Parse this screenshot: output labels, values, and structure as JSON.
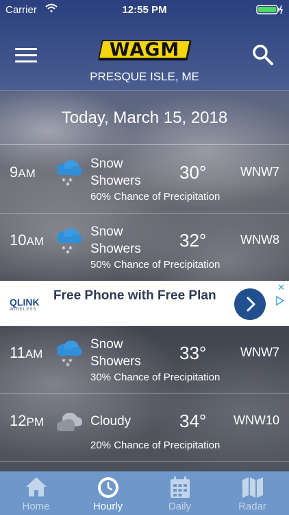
{
  "status_bar": {
    "carrier": "Carrier",
    "time": "12:55 PM"
  },
  "header": {
    "logo": "WAGM",
    "location": "PRESQUE ISLE, ME"
  },
  "date": "Today, March 15, 2018",
  "hours": [
    {
      "hour": "9",
      "ampm": "AM",
      "condition": "Snow Showers",
      "temp": "30°",
      "wind": "WNW7",
      "precip": "60% Chance of Precipitation",
      "icon": "snow-showers-icon"
    },
    {
      "hour": "10",
      "ampm": "AM",
      "condition": "Snow Showers",
      "temp": "32°",
      "wind": "WNW8",
      "precip": "50% Chance of Precipitation",
      "icon": "snow-showers-icon"
    },
    {
      "hour": "11",
      "ampm": "AM",
      "condition": "Snow Showers",
      "temp": "33°",
      "wind": "WNW7",
      "precip": "30% Chance of Precipitation",
      "icon": "snow-showers-icon"
    },
    {
      "hour": "12",
      "ampm": "PM",
      "condition": "Cloudy",
      "temp": "34°",
      "wind": "WNW10",
      "precip": "20% Chance of Precipitation",
      "icon": "cloudy-icon"
    }
  ],
  "ad": {
    "brand": "QLINK",
    "brand_sub": "WIRELESS",
    "text": "Free Phone with Free Plan"
  },
  "tabs": [
    {
      "label": "Home",
      "icon": "home-icon"
    },
    {
      "label": "Hourly",
      "icon": "clock-icon",
      "active": true
    },
    {
      "label": "Daily",
      "icon": "calendar-icon"
    },
    {
      "label": "Radar",
      "icon": "map-icon"
    }
  ],
  "colors": {
    "header": "#2e4a8f",
    "logo": "#f5d60c",
    "tabbar": "#6f97c9",
    "ad_button": "#22508f"
  }
}
